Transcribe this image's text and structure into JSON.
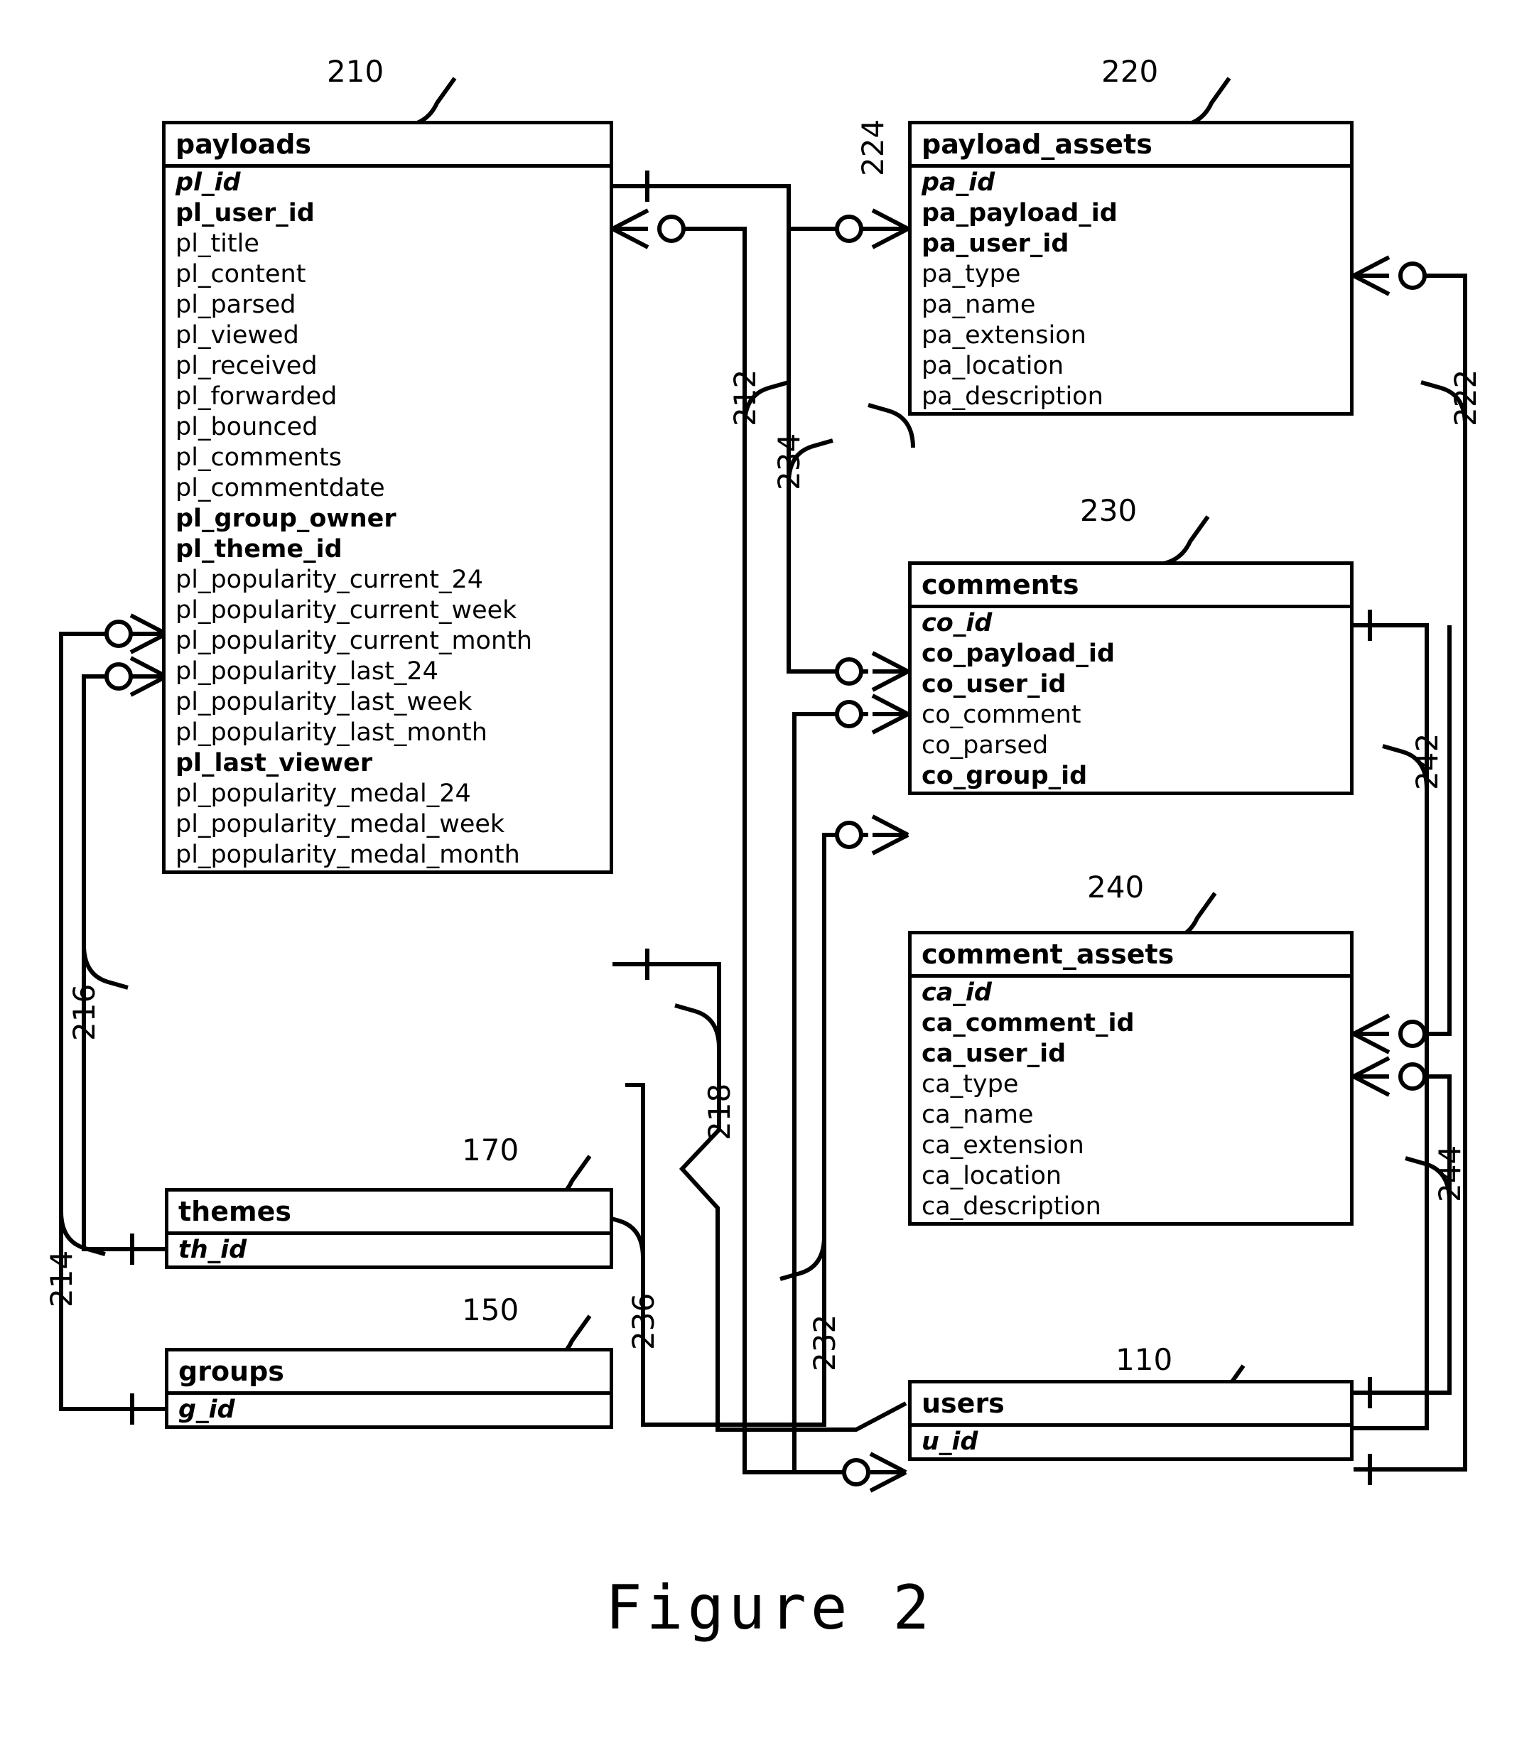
{
  "figure": {
    "caption": "Figure 2"
  },
  "tables": [
    {
      "id": "payloads",
      "ref": "210",
      "title": "payloads",
      "fields": [
        {
          "name": "pl_id",
          "key": "pk"
        },
        {
          "name": "pl_user_id",
          "key": "fk"
        },
        {
          "name": "pl_title",
          "key": ""
        },
        {
          "name": "pl_content",
          "key": ""
        },
        {
          "name": "pl_parsed",
          "key": ""
        },
        {
          "name": "pl_viewed",
          "key": ""
        },
        {
          "name": "pl_received",
          "key": ""
        },
        {
          "name": "pl_forwarded",
          "key": ""
        },
        {
          "name": "pl_bounced",
          "key": ""
        },
        {
          "name": "pl_comments",
          "key": ""
        },
        {
          "name": "pl_commentdate",
          "key": ""
        },
        {
          "name": "pl_group_owner",
          "key": "fk"
        },
        {
          "name": "pl_theme_id",
          "key": "fk"
        },
        {
          "name": "pl_popularity_current_24",
          "key": ""
        },
        {
          "name": "pl_popularity_current_week",
          "key": ""
        },
        {
          "name": "pl_popularity_current_month",
          "key": ""
        },
        {
          "name": "pl_popularity_last_24",
          "key": ""
        },
        {
          "name": "pl_popularity_last_week",
          "key": ""
        },
        {
          "name": "pl_popularity_last_month",
          "key": ""
        },
        {
          "name": "pl_last_viewer",
          "key": "fk"
        },
        {
          "name": "pl_popularity_medal_24",
          "key": ""
        },
        {
          "name": "pl_popularity_medal_week",
          "key": ""
        },
        {
          "name": "pl_popularity_medal_month",
          "key": ""
        }
      ]
    },
    {
      "id": "payload_assets",
      "ref": "220",
      "title": "payload_assets",
      "fields": [
        {
          "name": "pa_id",
          "key": "pk"
        },
        {
          "name": "pa_payload_id",
          "key": "fk"
        },
        {
          "name": "pa_user_id",
          "key": "fk"
        },
        {
          "name": "pa_type",
          "key": ""
        },
        {
          "name": "pa_name",
          "key": ""
        },
        {
          "name": "pa_extension",
          "key": ""
        },
        {
          "name": "pa_location",
          "key": ""
        },
        {
          "name": "pa_description",
          "key": ""
        }
      ]
    },
    {
      "id": "comments",
      "ref": "230",
      "title": "comments",
      "fields": [
        {
          "name": "co_id",
          "key": "pk"
        },
        {
          "name": "co_payload_id",
          "key": "fk"
        },
        {
          "name": "co_user_id",
          "key": "fk"
        },
        {
          "name": "co_comment",
          "key": ""
        },
        {
          "name": "co_parsed",
          "key": ""
        },
        {
          "name": "co_group_id",
          "key": "fk"
        }
      ]
    },
    {
      "id": "comment_assets",
      "ref": "240",
      "title": "comment_assets",
      "fields": [
        {
          "name": "ca_id",
          "key": "pk"
        },
        {
          "name": "ca_comment_id",
          "key": "fk"
        },
        {
          "name": "ca_user_id",
          "key": "fk"
        },
        {
          "name": "ca_type",
          "key": ""
        },
        {
          "name": "ca_name",
          "key": ""
        },
        {
          "name": "ca_extension",
          "key": ""
        },
        {
          "name": "ca_location",
          "key": ""
        },
        {
          "name": "ca_description",
          "key": ""
        }
      ]
    },
    {
      "id": "themes",
      "ref": "170",
      "title": "themes",
      "fields": [
        {
          "name": "th_id",
          "key": "pk"
        }
      ]
    },
    {
      "id": "groups",
      "ref": "150",
      "title": "groups",
      "fields": [
        {
          "name": "g_id",
          "key": "pk"
        }
      ]
    },
    {
      "id": "users",
      "ref": "110",
      "title": "users",
      "fields": [
        {
          "name": "u_id",
          "key": "pk"
        }
      ]
    }
  ],
  "relationship_refs": [
    {
      "id": "r212",
      "label": "212"
    },
    {
      "id": "r214",
      "label": "214"
    },
    {
      "id": "r216",
      "label": "216"
    },
    {
      "id": "r218",
      "label": "218"
    },
    {
      "id": "r222",
      "label": "222"
    },
    {
      "id": "r224",
      "label": "224"
    },
    {
      "id": "r232",
      "label": "232"
    },
    {
      "id": "r234",
      "label": "234"
    },
    {
      "id": "r236",
      "label": "236"
    },
    {
      "id": "r242",
      "label": "242"
    },
    {
      "id": "r244",
      "label": "244"
    }
  ],
  "table_refs": {
    "payloads": "210",
    "payload_assets": "220",
    "comments": "230",
    "comment_assets": "240",
    "themes": "170",
    "groups": "150",
    "users": "110"
  },
  "colors": {
    "line": "#000000",
    "background": "#ffffff"
  }
}
